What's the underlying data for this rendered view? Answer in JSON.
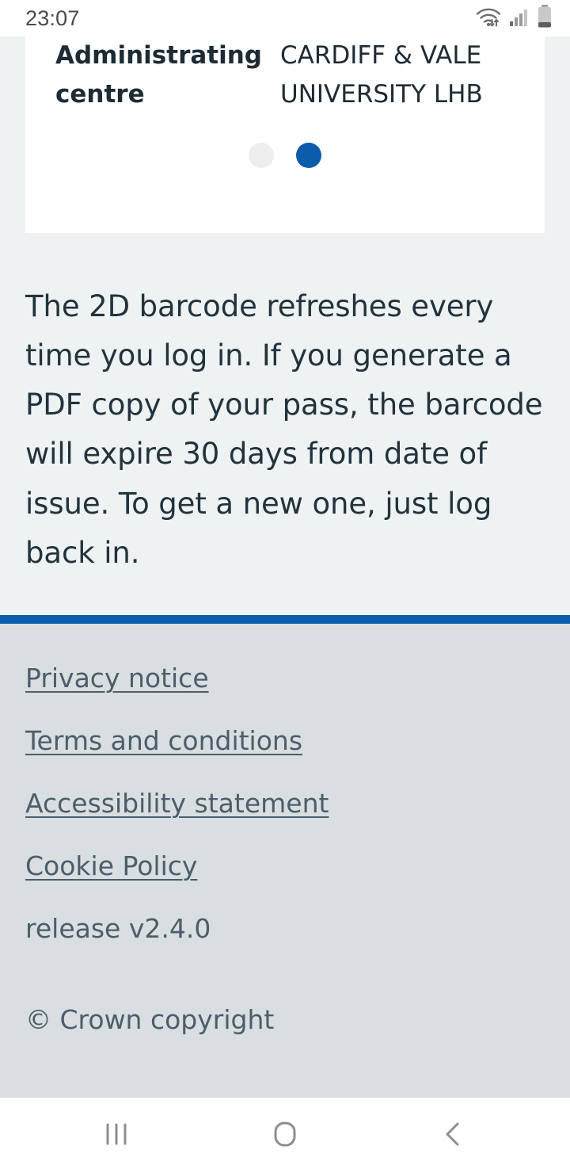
{
  "status_bar": {
    "time": "23:07",
    "icons": [
      "wifi-icon",
      "signal-icon",
      "battery-icon"
    ]
  },
  "card": {
    "label": "Administrating centre",
    "value": "CARDIFF & VALE UNIVERSITY LHB",
    "carousel": {
      "dots": 2,
      "active_index": 1,
      "inactive_color": "#eeeeee",
      "active_color": "#0b5cab"
    }
  },
  "main": {
    "body_text": "The 2D barcode refreshes every time you log in. If you generate a PDF copy of your pass, the barcode will expire 30 days from date of issue. To get a new one, just log back in."
  },
  "footer": {
    "rule_color": "#0b5cab",
    "background": "#d9dee0",
    "links": [
      {
        "label": "Privacy notice"
      },
      {
        "label": "Terms and conditions"
      },
      {
        "label": "Accessibility statement"
      },
      {
        "label": "Cookie Policy"
      }
    ],
    "release": "release v2.4.0",
    "copyright": "© Crown copyright"
  },
  "nav_bar": {
    "recents": "recents-icon",
    "home": "home-icon",
    "back": "back-icon"
  }
}
